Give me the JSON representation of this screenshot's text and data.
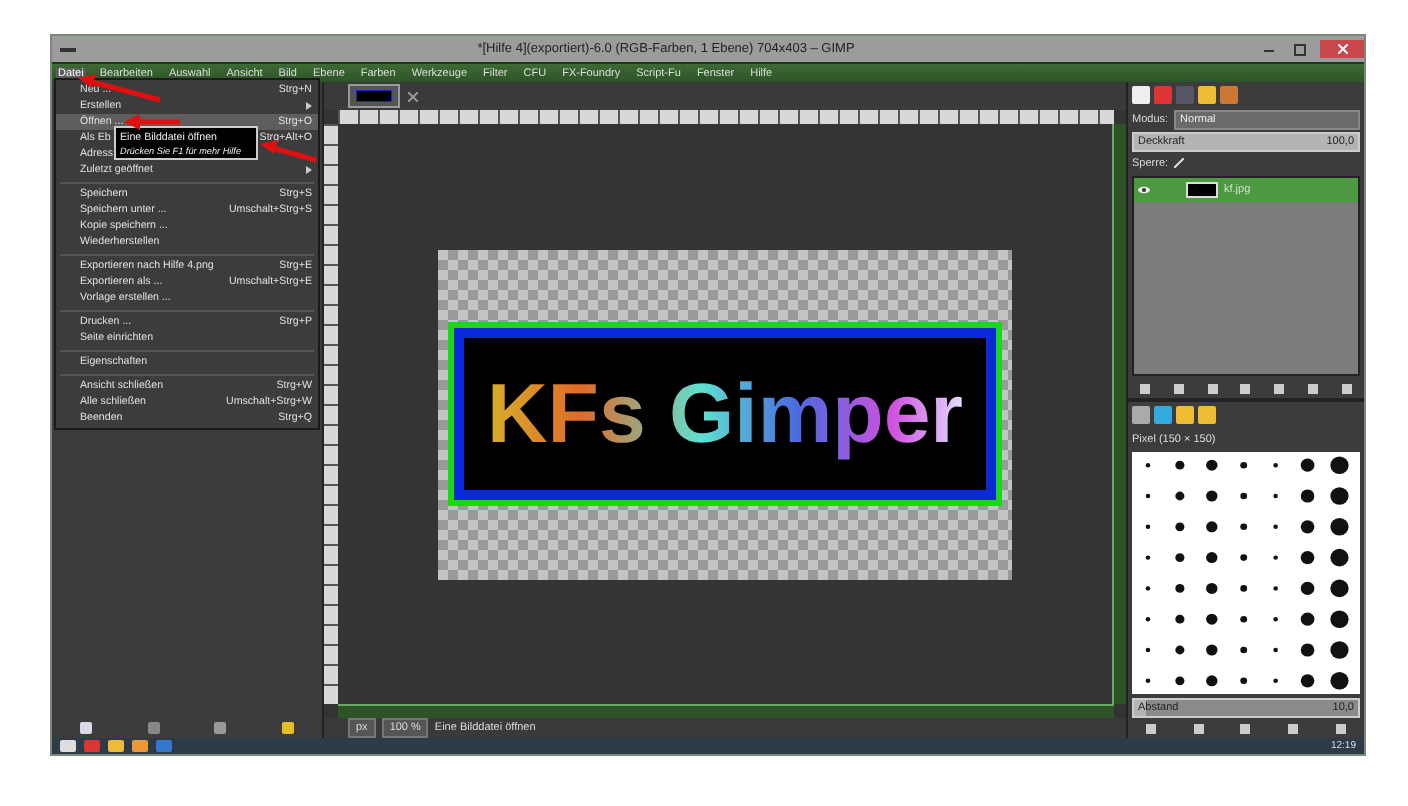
{
  "window": {
    "title": "*[Hilfe 4](exportiert)-6.0 (RGB-Farben, 1 Ebene) 704x403 – GIMP"
  },
  "menubar": [
    {
      "label": "Datei",
      "selected": true
    },
    {
      "label": "Bearbeiten",
      "selected": false
    },
    {
      "label": "Auswahl",
      "selected": false
    },
    {
      "label": "Ansicht",
      "selected": false
    },
    {
      "label": "Bild",
      "selected": false
    },
    {
      "label": "Ebene",
      "selected": false
    },
    {
      "label": "Farben",
      "selected": false
    },
    {
      "label": "Werkzeuge",
      "selected": false
    },
    {
      "label": "Filter",
      "selected": false
    },
    {
      "label": "CFU",
      "selected": false
    },
    {
      "label": "FX-Foundry",
      "selected": false
    },
    {
      "label": "Script-Fu",
      "selected": false
    },
    {
      "label": "Fenster",
      "selected": false
    },
    {
      "label": "Hilfe",
      "selected": false
    }
  ],
  "file_menu": [
    {
      "kind": "item",
      "label": "Neu ...",
      "shortcut": "Strg+N",
      "highlighted": false,
      "submenu": false
    },
    {
      "kind": "item",
      "label": "Erstellen",
      "highlighted": false,
      "submenu": true
    },
    {
      "kind": "item",
      "label": "Öffnen ...",
      "shortcut": "Strg+O",
      "highlighted": true,
      "submenu": false
    },
    {
      "kind": "item",
      "label": "Als Eb",
      "shortcut": "Strg+Alt+O",
      "highlighted": false,
      "submenu": false
    },
    {
      "kind": "item",
      "label": "Adress",
      "highlighted": false,
      "submenu": false
    },
    {
      "kind": "item",
      "label": "Zuletzt geöffnet",
      "highlighted": false,
      "submenu": true
    },
    {
      "kind": "separator"
    },
    {
      "kind": "item",
      "label": "Speichern",
      "shortcut": "Strg+S",
      "highlighted": false,
      "submenu": false
    },
    {
      "kind": "item",
      "label": "Speichern unter ...",
      "shortcut": "Umschalt+Strg+S",
      "highlighted": false,
      "submenu": false
    },
    {
      "kind": "item",
      "label": "Kopie speichern ...",
      "highlighted": false,
      "submenu": false
    },
    {
      "kind": "item",
      "label": "Wiederherstellen",
      "highlighted": false,
      "submenu": false
    },
    {
      "kind": "separator"
    },
    {
      "kind": "item",
      "label": "Exportieren nach Hilfe 4.png",
      "shortcut": "Strg+E",
      "highlighted": false,
      "submenu": false
    },
    {
      "kind": "item",
      "label": "Exportieren als ...",
      "shortcut": "Umschalt+Strg+E",
      "highlighted": false,
      "submenu": false
    },
    {
      "kind": "item",
      "label": "Vorlage erstellen ...",
      "highlighted": false,
      "submenu": false
    },
    {
      "kind": "separator"
    },
    {
      "kind": "item",
      "label": "Drucken ...",
      "shortcut": "Strg+P",
      "highlighted": false,
      "submenu": false
    },
    {
      "kind": "item",
      "label": "Seite einrichten",
      "highlighted": false,
      "submenu": false
    },
    {
      "kind": "separator"
    },
    {
      "kind": "item",
      "label": "Eigenschaften",
      "highlighted": false,
      "submenu": false
    },
    {
      "kind": "separator"
    },
    {
      "kind": "item",
      "label": "Ansicht schließen",
      "shortcut": "Strg+W",
      "highlighted": false,
      "submenu": false
    },
    {
      "kind": "item",
      "label": "Alle schließen",
      "shortcut": "Umschalt+Strg+W",
      "highlighted": false,
      "submenu": false
    },
    {
      "kind": "item",
      "label": "Beenden",
      "shortcut": "Strg+Q",
      "highlighted": false,
      "submenu": false
    }
  ],
  "tooltip": {
    "title": "Eine Bilddatei öffnen",
    "hint": "Drücken Sie F1 für mehr Hilfe"
  },
  "canvas": {
    "image_text": "KFs Gimper"
  },
  "status_bar": {
    "unit": "px",
    "zoom": "100 %",
    "message": "Eine Bilddatei öffnen"
  },
  "layers_panel": {
    "mode_label": "Modus:",
    "mode": "Normal",
    "opacity": {
      "label": "Deckkraft",
      "value": "100,0",
      "level": 1.0
    },
    "lock_label": "Sperre:",
    "layers": [
      {
        "name": "kf.jpg",
        "selected": true,
        "visible": true
      }
    ]
  },
  "brushes_panel": {
    "brush_name": "Pixel (150 × 150)",
    "spacing": {
      "label": "Abstand",
      "value": "10,0",
      "level": 0.05
    }
  },
  "taskbar": {
    "time": "12:19"
  }
}
